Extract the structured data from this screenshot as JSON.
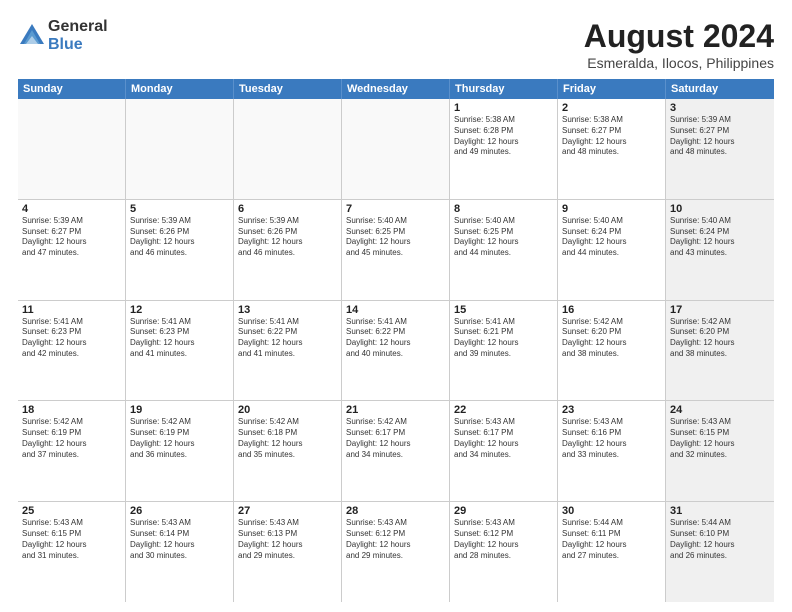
{
  "logo": {
    "general": "General",
    "blue": "Blue"
  },
  "title": "August 2024",
  "subtitle": "Esmeralda, Ilocos, Philippines",
  "days": [
    "Sunday",
    "Monday",
    "Tuesday",
    "Wednesday",
    "Thursday",
    "Friday",
    "Saturday"
  ],
  "weeks": [
    [
      {
        "day": "",
        "text": "",
        "empty": true
      },
      {
        "day": "",
        "text": "",
        "empty": true
      },
      {
        "day": "",
        "text": "",
        "empty": true
      },
      {
        "day": "",
        "text": "",
        "empty": true
      },
      {
        "day": "1",
        "text": "Sunrise: 5:38 AM\nSunset: 6:28 PM\nDaylight: 12 hours\nand 49 minutes.",
        "shaded": false
      },
      {
        "day": "2",
        "text": "Sunrise: 5:38 AM\nSunset: 6:27 PM\nDaylight: 12 hours\nand 48 minutes.",
        "shaded": false
      },
      {
        "day": "3",
        "text": "Sunrise: 5:39 AM\nSunset: 6:27 PM\nDaylight: 12 hours\nand 48 minutes.",
        "shaded": true
      }
    ],
    [
      {
        "day": "4",
        "text": "Sunrise: 5:39 AM\nSunset: 6:27 PM\nDaylight: 12 hours\nand 47 minutes.",
        "shaded": false
      },
      {
        "day": "5",
        "text": "Sunrise: 5:39 AM\nSunset: 6:26 PM\nDaylight: 12 hours\nand 46 minutes.",
        "shaded": false
      },
      {
        "day": "6",
        "text": "Sunrise: 5:39 AM\nSunset: 6:26 PM\nDaylight: 12 hours\nand 46 minutes.",
        "shaded": false
      },
      {
        "day": "7",
        "text": "Sunrise: 5:40 AM\nSunset: 6:25 PM\nDaylight: 12 hours\nand 45 minutes.",
        "shaded": false
      },
      {
        "day": "8",
        "text": "Sunrise: 5:40 AM\nSunset: 6:25 PM\nDaylight: 12 hours\nand 44 minutes.",
        "shaded": false
      },
      {
        "day": "9",
        "text": "Sunrise: 5:40 AM\nSunset: 6:24 PM\nDaylight: 12 hours\nand 44 minutes.",
        "shaded": false
      },
      {
        "day": "10",
        "text": "Sunrise: 5:40 AM\nSunset: 6:24 PM\nDaylight: 12 hours\nand 43 minutes.",
        "shaded": true
      }
    ],
    [
      {
        "day": "11",
        "text": "Sunrise: 5:41 AM\nSunset: 6:23 PM\nDaylight: 12 hours\nand 42 minutes.",
        "shaded": false
      },
      {
        "day": "12",
        "text": "Sunrise: 5:41 AM\nSunset: 6:23 PM\nDaylight: 12 hours\nand 41 minutes.",
        "shaded": false
      },
      {
        "day": "13",
        "text": "Sunrise: 5:41 AM\nSunset: 6:22 PM\nDaylight: 12 hours\nand 41 minutes.",
        "shaded": false
      },
      {
        "day": "14",
        "text": "Sunrise: 5:41 AM\nSunset: 6:22 PM\nDaylight: 12 hours\nand 40 minutes.",
        "shaded": false
      },
      {
        "day": "15",
        "text": "Sunrise: 5:41 AM\nSunset: 6:21 PM\nDaylight: 12 hours\nand 39 minutes.",
        "shaded": false
      },
      {
        "day": "16",
        "text": "Sunrise: 5:42 AM\nSunset: 6:20 PM\nDaylight: 12 hours\nand 38 minutes.",
        "shaded": false
      },
      {
        "day": "17",
        "text": "Sunrise: 5:42 AM\nSunset: 6:20 PM\nDaylight: 12 hours\nand 38 minutes.",
        "shaded": true
      }
    ],
    [
      {
        "day": "18",
        "text": "Sunrise: 5:42 AM\nSunset: 6:19 PM\nDaylight: 12 hours\nand 37 minutes.",
        "shaded": false
      },
      {
        "day": "19",
        "text": "Sunrise: 5:42 AM\nSunset: 6:19 PM\nDaylight: 12 hours\nand 36 minutes.",
        "shaded": false
      },
      {
        "day": "20",
        "text": "Sunrise: 5:42 AM\nSunset: 6:18 PM\nDaylight: 12 hours\nand 35 minutes.",
        "shaded": false
      },
      {
        "day": "21",
        "text": "Sunrise: 5:42 AM\nSunset: 6:17 PM\nDaylight: 12 hours\nand 34 minutes.",
        "shaded": false
      },
      {
        "day": "22",
        "text": "Sunrise: 5:43 AM\nSunset: 6:17 PM\nDaylight: 12 hours\nand 34 minutes.",
        "shaded": false
      },
      {
        "day": "23",
        "text": "Sunrise: 5:43 AM\nSunset: 6:16 PM\nDaylight: 12 hours\nand 33 minutes.",
        "shaded": false
      },
      {
        "day": "24",
        "text": "Sunrise: 5:43 AM\nSunset: 6:15 PM\nDaylight: 12 hours\nand 32 minutes.",
        "shaded": true
      }
    ],
    [
      {
        "day": "25",
        "text": "Sunrise: 5:43 AM\nSunset: 6:15 PM\nDaylight: 12 hours\nand 31 minutes.",
        "shaded": false
      },
      {
        "day": "26",
        "text": "Sunrise: 5:43 AM\nSunset: 6:14 PM\nDaylight: 12 hours\nand 30 minutes.",
        "shaded": false
      },
      {
        "day": "27",
        "text": "Sunrise: 5:43 AM\nSunset: 6:13 PM\nDaylight: 12 hours\nand 29 minutes.",
        "shaded": false
      },
      {
        "day": "28",
        "text": "Sunrise: 5:43 AM\nSunset: 6:12 PM\nDaylight: 12 hours\nand 29 minutes.",
        "shaded": false
      },
      {
        "day": "29",
        "text": "Sunrise: 5:43 AM\nSunset: 6:12 PM\nDaylight: 12 hours\nand 28 minutes.",
        "shaded": false
      },
      {
        "day": "30",
        "text": "Sunrise: 5:44 AM\nSunset: 6:11 PM\nDaylight: 12 hours\nand 27 minutes.",
        "shaded": false
      },
      {
        "day": "31",
        "text": "Sunrise: 5:44 AM\nSunset: 6:10 PM\nDaylight: 12 hours\nand 26 minutes.",
        "shaded": true
      }
    ]
  ]
}
